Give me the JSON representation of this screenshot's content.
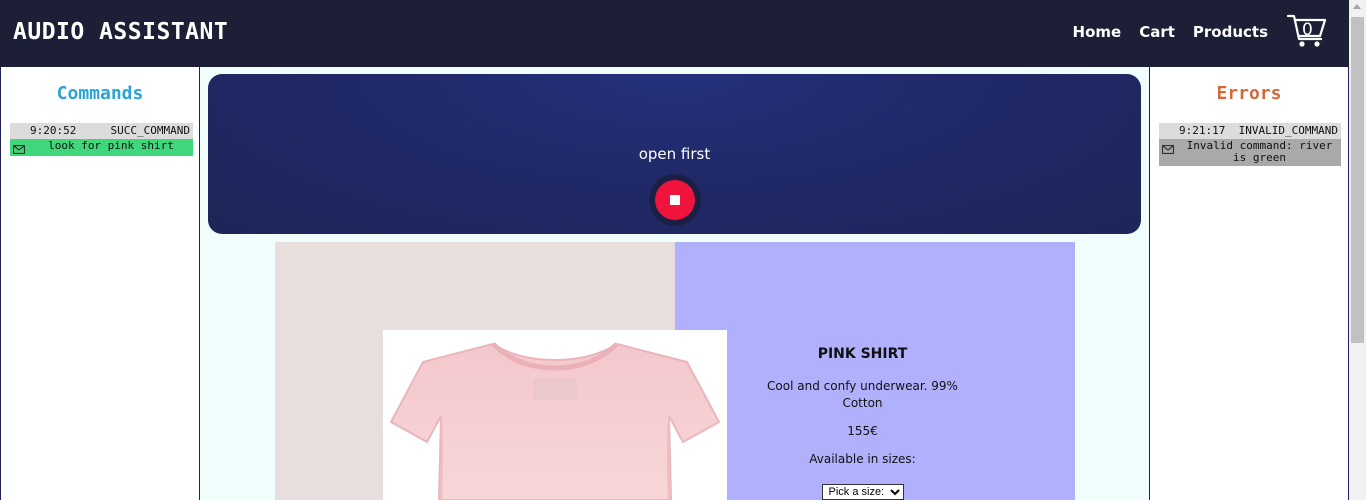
{
  "header": {
    "brand": "AUDIO ASSISTANT",
    "nav": [
      {
        "label": "Home"
      },
      {
        "label": "Cart"
      },
      {
        "label": "Products"
      }
    ],
    "cart_count": "0",
    "cart_icon": "shopping-cart-icon"
  },
  "commands_panel": {
    "title": "Commands",
    "entries": [
      {
        "time": "9:20:52",
        "status": "SUCC_COMMAND",
        "text": "look for pink shirt",
        "icon": "mail-icon",
        "color": "#40d67b"
      }
    ]
  },
  "errors_panel": {
    "title": "Errors",
    "entries": [
      {
        "time": "9:21:17",
        "status": "INVALID_COMMAND",
        "text": "Invalid command: river is green",
        "icon": "mail-icon",
        "color": "#a9a9a9"
      }
    ]
  },
  "voice": {
    "transcript": "open first",
    "record_state": "recording",
    "button_icon": "stop-icon"
  },
  "product": {
    "name": "PINK SHIRT",
    "description": "Cool and confy underwear. 99% Cotton",
    "price": "155€",
    "sizes_label": "Available in sizes:",
    "size_select_placeholder": "Pick a size:",
    "image_alt": "pink shirt"
  },
  "colors": {
    "header_bg": "#1c1f35",
    "commands_title": "#2ba3d6",
    "errors_title": "#d2693a",
    "record_button": "#f0143c",
    "info_bg": "#b1b0fd"
  }
}
